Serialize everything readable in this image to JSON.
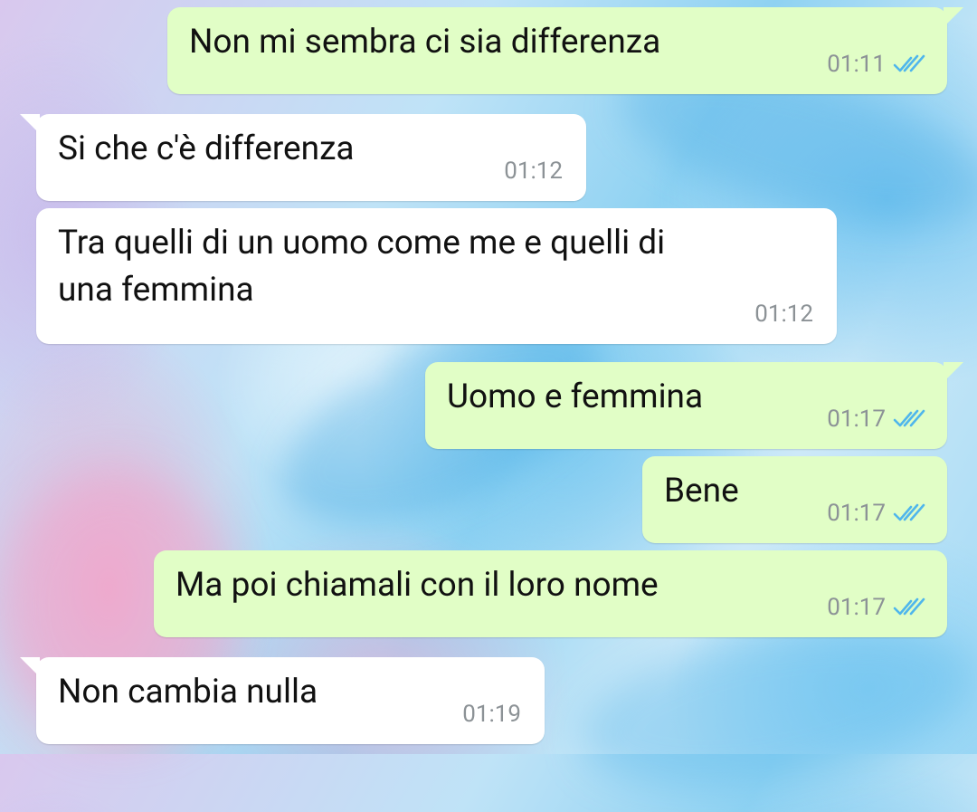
{
  "colors": {
    "incoming_bubble": "#ffffff",
    "outgoing_bubble": "#e1fec6",
    "text": "#111111",
    "timestamp": "#8c9296",
    "read_ticks": "#4fb6ec"
  },
  "messages": [
    {
      "direction": "outgoing",
      "text": "Non mi sembra ci sia differenza",
      "time": "01:11",
      "status_icon": "double-check-read-icon"
    },
    {
      "direction": "incoming",
      "text": "Si che c'è differenza",
      "time": "01:12"
    },
    {
      "direction": "incoming",
      "text": "Tra quelli di un uomo come me e quelli di\nuna femmina",
      "time": "01:12"
    },
    {
      "direction": "outgoing",
      "text": "Uomo e femmina",
      "time": "01:17",
      "status_icon": "double-check-read-icon"
    },
    {
      "direction": "outgoing",
      "text": "Bene",
      "time": "01:17",
      "status_icon": "double-check-read-icon"
    },
    {
      "direction": "outgoing",
      "text": "Ma poi chiamali con il loro nome",
      "time": "01:17",
      "status_icon": "double-check-read-icon"
    },
    {
      "direction": "incoming",
      "text": "Non cambia nulla",
      "time": "01:19"
    }
  ]
}
